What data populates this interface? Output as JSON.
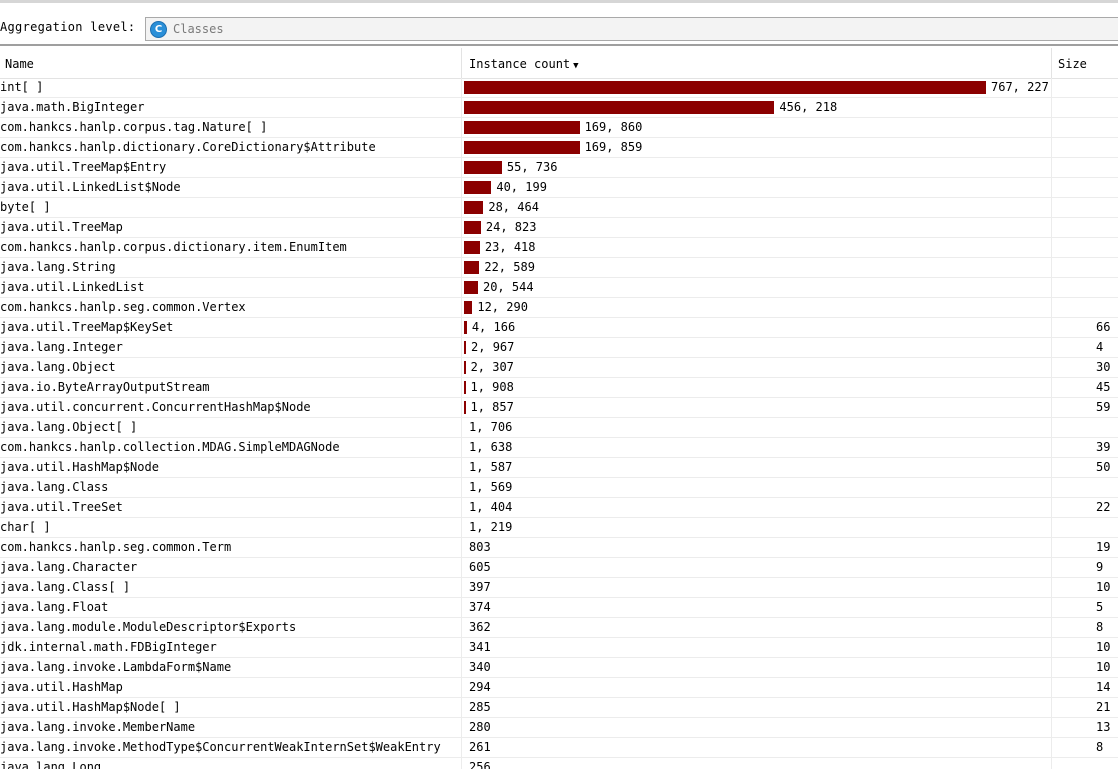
{
  "aggregation": {
    "label": "Aggregation level:",
    "icon": "class-icon",
    "icon_glyph": "C",
    "value": "Classes"
  },
  "columns": {
    "name": "Name",
    "count": "Instance count",
    "size": "Size"
  },
  "sort": {
    "column": "count",
    "direction": "descending"
  },
  "bar_color": "#8b0000",
  "max_count": 767227,
  "rows": [
    {
      "name": "int[ ]",
      "count": "767, 227",
      "value": 767227,
      "size": ""
    },
    {
      "name": "java.math.BigInteger",
      "count": "456, 218",
      "value": 456218,
      "size": ""
    },
    {
      "name": "com.hankcs.hanlp.corpus.tag.Nature[ ]",
      "count": "169, 860",
      "value": 169860,
      "size": ""
    },
    {
      "name": "com.hankcs.hanlp.dictionary.CoreDictionary$Attribute",
      "count": "169, 859",
      "value": 169859,
      "size": ""
    },
    {
      "name": "java.util.TreeMap$Entry",
      "count": "55, 736",
      "value": 55736,
      "size": ""
    },
    {
      "name": "java.util.LinkedList$Node",
      "count": "40, 199",
      "value": 40199,
      "size": ""
    },
    {
      "name": "byte[ ]",
      "count": "28, 464",
      "value": 28464,
      "size": ""
    },
    {
      "name": "java.util.TreeMap",
      "count": "24, 823",
      "value": 24823,
      "size": ""
    },
    {
      "name": "com.hankcs.hanlp.corpus.dictionary.item.EnumItem",
      "count": "23, 418",
      "value": 23418,
      "size": ""
    },
    {
      "name": "java.lang.String",
      "count": "22, 589",
      "value": 22589,
      "size": ""
    },
    {
      "name": "java.util.LinkedList",
      "count": "20, 544",
      "value": 20544,
      "size": ""
    },
    {
      "name": "com.hankcs.hanlp.seg.common.Vertex",
      "count": "12, 290",
      "value": 12290,
      "size": ""
    },
    {
      "name": "java.util.TreeMap$KeySet",
      "count": "4, 166",
      "value": 4166,
      "size": "66"
    },
    {
      "name": "java.lang.Integer",
      "count": "2, 967",
      "value": 2967,
      "size": "4"
    },
    {
      "name": "java.lang.Object",
      "count": "2, 307",
      "value": 2307,
      "size": "30"
    },
    {
      "name": "java.io.ByteArrayOutputStream",
      "count": "1, 908",
      "value": 1908,
      "size": "45"
    },
    {
      "name": "java.util.concurrent.ConcurrentHashMap$Node",
      "count": "1, 857",
      "value": 1857,
      "size": "59"
    },
    {
      "name": "java.lang.Object[ ]",
      "count": "1, 706",
      "value": 1706,
      "size": ""
    },
    {
      "name": "com.hankcs.hanlp.collection.MDAG.SimpleMDAGNode",
      "count": "1, 638",
      "value": 1638,
      "size": "39"
    },
    {
      "name": "java.util.HashMap$Node",
      "count": "1, 587",
      "value": 1587,
      "size": "50"
    },
    {
      "name": "java.lang.Class",
      "count": "1, 569",
      "value": 1569,
      "size": ""
    },
    {
      "name": "java.util.TreeSet",
      "count": "1, 404",
      "value": 1404,
      "size": "22"
    },
    {
      "name": "char[ ]",
      "count": "1, 219",
      "value": 1219,
      "size": ""
    },
    {
      "name": "com.hankcs.hanlp.seg.common.Term",
      "count": "803",
      "value": 803,
      "size": "19"
    },
    {
      "name": "java.lang.Character",
      "count": "605",
      "value": 605,
      "size": "9"
    },
    {
      "name": "java.lang.Class[ ]",
      "count": "397",
      "value": 397,
      "size": "10"
    },
    {
      "name": "java.lang.Float",
      "count": "374",
      "value": 374,
      "size": "5"
    },
    {
      "name": "java.lang.module.ModuleDescriptor$Exports",
      "count": "362",
      "value": 362,
      "size": "8"
    },
    {
      "name": "jdk.internal.math.FDBigInteger",
      "count": "341",
      "value": 341,
      "size": "10"
    },
    {
      "name": "java.lang.invoke.LambdaForm$Name",
      "count": "340",
      "value": 340,
      "size": "10"
    },
    {
      "name": "java.util.HashMap",
      "count": "294",
      "value": 294,
      "size": "14"
    },
    {
      "name": "java.util.HashMap$Node[ ]",
      "count": "285",
      "value": 285,
      "size": "21"
    },
    {
      "name": "java.lang.invoke.MemberName",
      "count": "280",
      "value": 280,
      "size": "13"
    },
    {
      "name": "java.lang.invoke.MethodType$ConcurrentWeakInternSet$WeakEntry",
      "count": "261",
      "value": 261,
      "size": "8"
    },
    {
      "name": "java.lang.Long",
      "count": "256",
      "value": 256,
      "size": ""
    }
  ]
}
